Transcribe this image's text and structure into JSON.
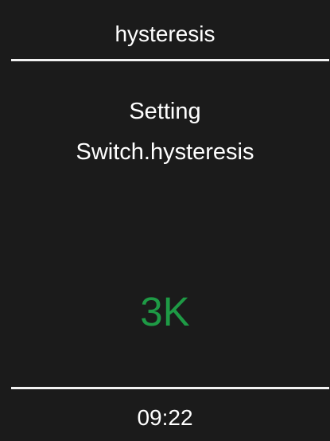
{
  "header": {
    "title": "hysteresis"
  },
  "main": {
    "setting_line_1": "Setting",
    "setting_line_2": "Switch.hysteresis",
    "value": "3K",
    "value_color": "#1e9a45"
  },
  "footer": {
    "time": "09:22"
  },
  "colors": {
    "background": "#1b1b1b",
    "text": "#ffffff",
    "divider": "#f2f2f2"
  }
}
